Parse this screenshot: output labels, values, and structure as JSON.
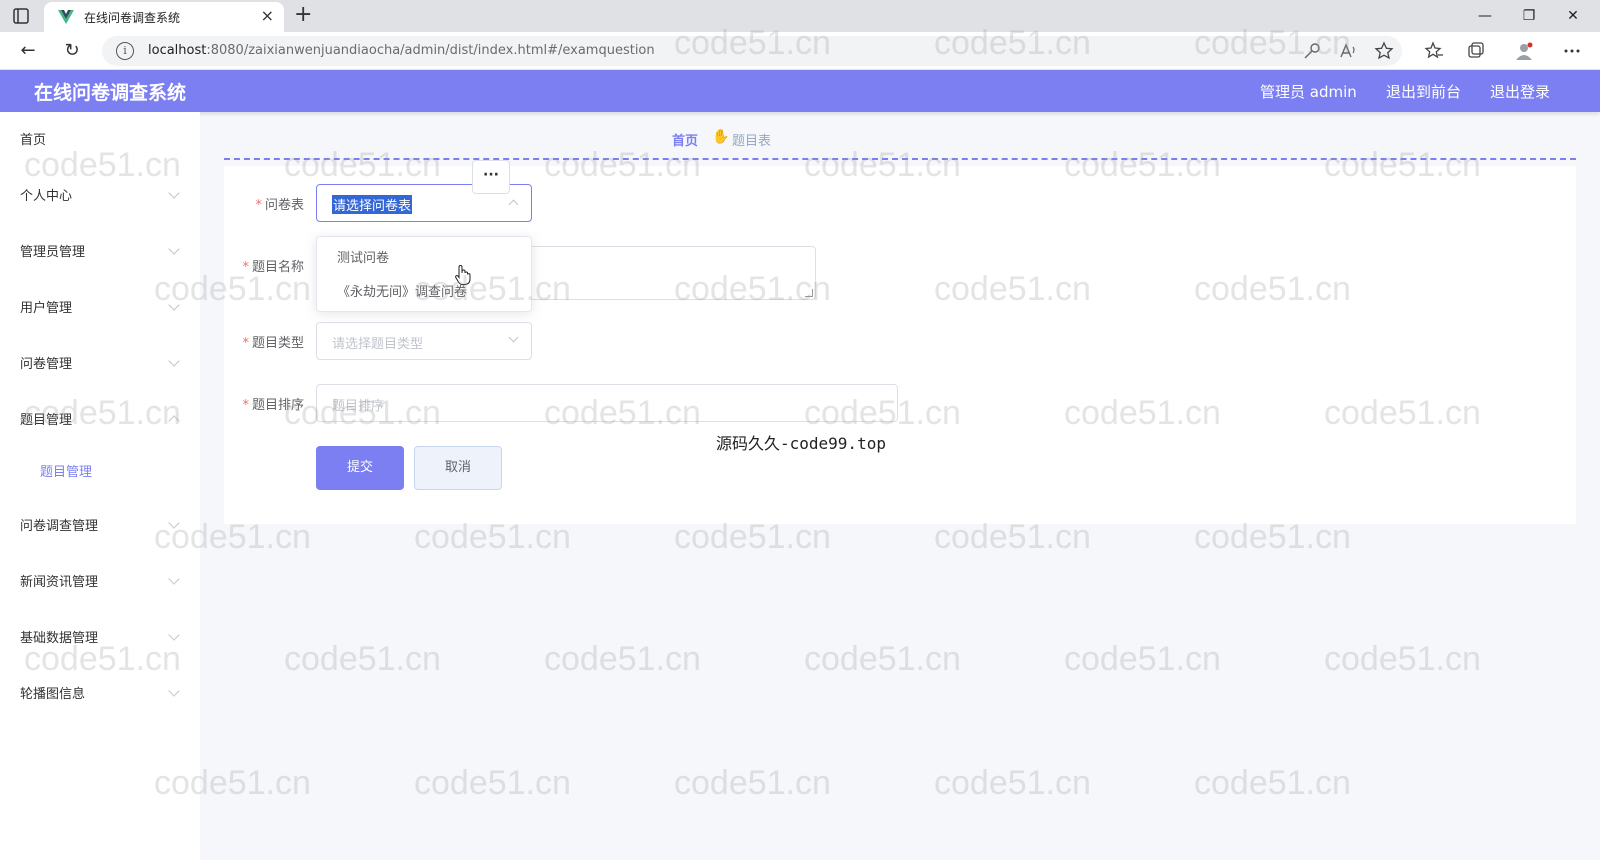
{
  "browser": {
    "tab_title": "在线问卷调查系统",
    "tab_close": "×",
    "new_tab": "+",
    "minimize": "—",
    "restore": "❐",
    "close": "✕",
    "back": "←",
    "refresh": "↻",
    "info": "i",
    "url_host": "localhost",
    "url_path": ":8080/zaixianwenjuandiaocha/admin/dist/index.html#/examquestion"
  },
  "header": {
    "title": "在线问卷调查系统",
    "user_label": "管理员 admin",
    "front_link": "退出到前台",
    "logout_link": "退出登录",
    "accent_color": "#7b7ff1"
  },
  "sidebar": {
    "items": [
      {
        "label": "首页"
      },
      {
        "label": "个人中心"
      },
      {
        "label": "管理员管理"
      },
      {
        "label": "用户管理"
      },
      {
        "label": "问卷管理"
      },
      {
        "label": "题目管理"
      },
      {
        "label": "问卷调查管理"
      },
      {
        "label": "新闻资讯管理"
      },
      {
        "label": "基础数据管理"
      },
      {
        "label": "轮播图信息"
      }
    ],
    "sub_item": "题目管理"
  },
  "breadcrumb": {
    "home": "首页",
    "separator": "✋",
    "current": "题目表"
  },
  "form": {
    "survey_label": "问卷表",
    "survey_placeholder": "请选择问卷表",
    "name_label": "题目名称",
    "type_label": "题目类型",
    "type_placeholder": "请选择题目类型",
    "order_label": "题目排序",
    "order_placeholder": "题目排序",
    "required_mark": "*",
    "submit": "提交",
    "cancel": "取消"
  },
  "dropdown": {
    "options": [
      "测试问卷",
      "《永劫无间》调查问卷"
    ]
  },
  "more_button": "···",
  "banner": "源码久久-code99.top",
  "watermark": "code51.cn"
}
